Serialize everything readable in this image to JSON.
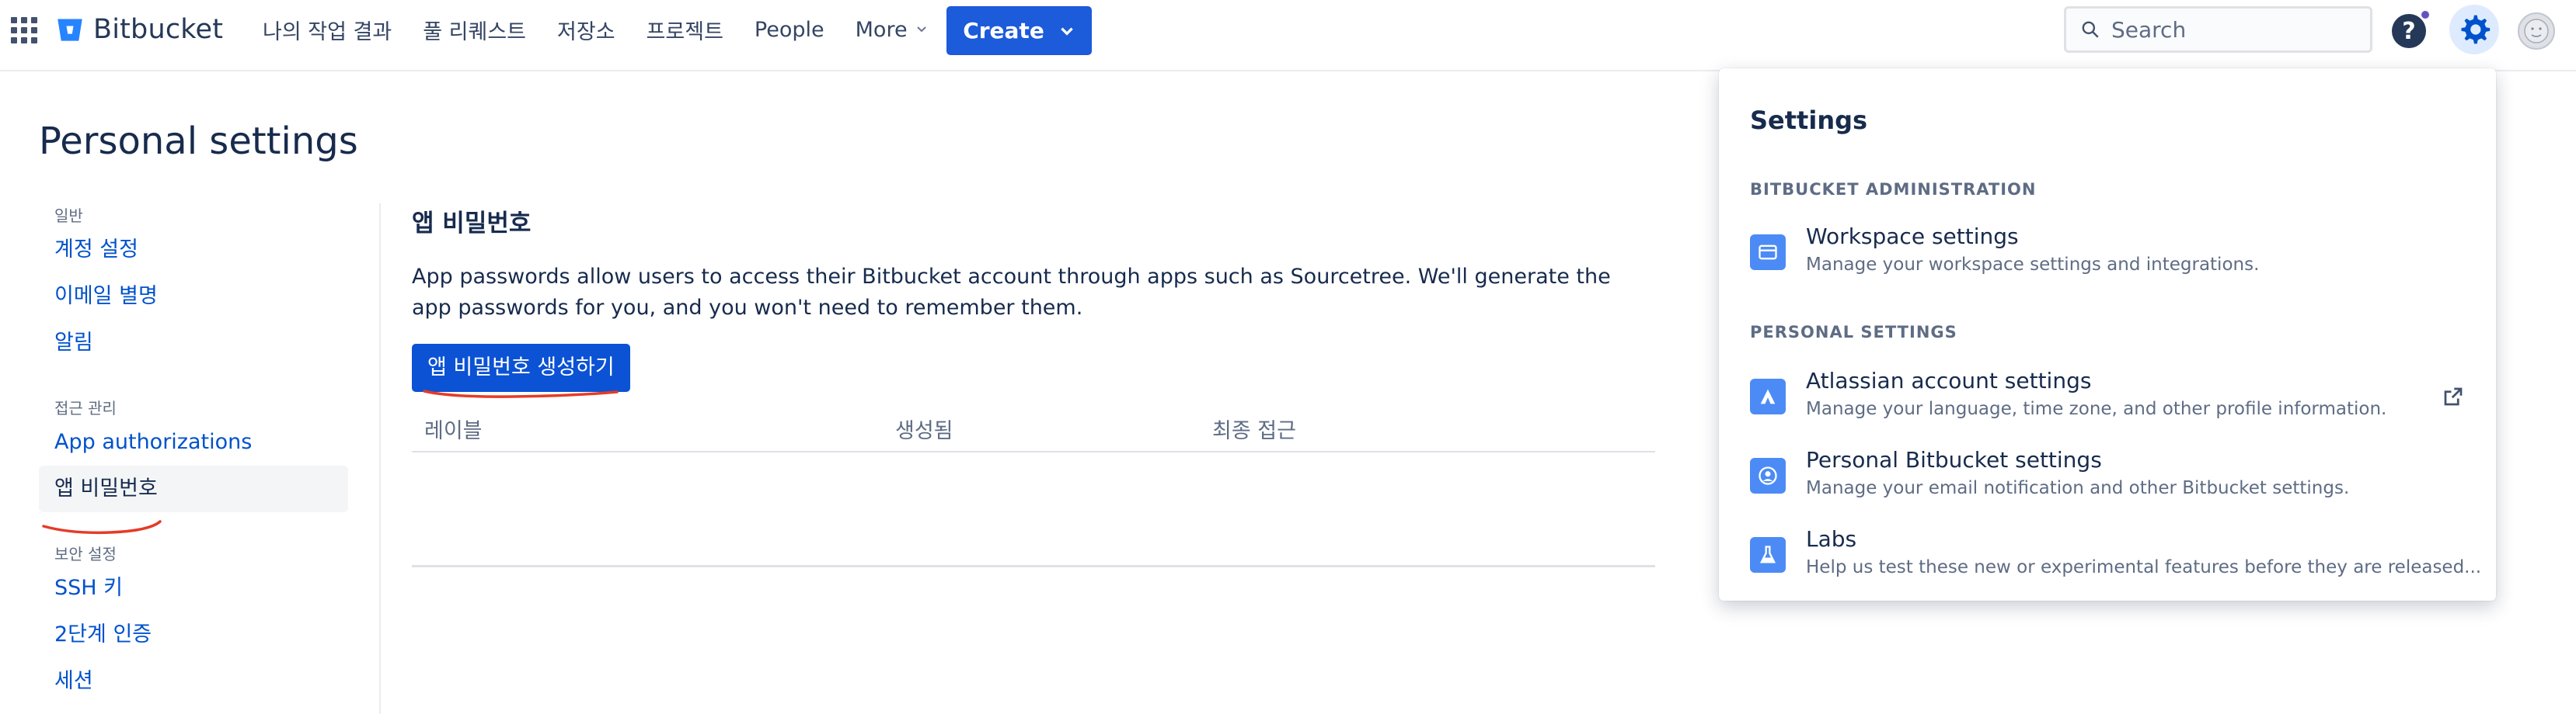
{
  "header": {
    "brand": "Bitbucket",
    "nav": [
      "나의 작업 결과",
      "풀 리퀘스트",
      "저장소",
      "프로젝트",
      "People"
    ],
    "more_label": "More",
    "create_label": "Create",
    "search_placeholder": "Search",
    "help_label": "?"
  },
  "page": {
    "title": "Personal settings"
  },
  "sidebar": {
    "sections": [
      {
        "heading": "일반",
        "items": [
          "계정 설정",
          "이메일 별명",
          "알림"
        ]
      },
      {
        "heading": "접근 관리",
        "items": [
          "App authorizations",
          "앱 비밀번호"
        ]
      },
      {
        "heading": "보안 설정",
        "items": [
          "SSH 키",
          "2단계 인증",
          "세션"
        ]
      }
    ],
    "active_item": "앱 비밀번호"
  },
  "content": {
    "title": "앱 비밀번호",
    "description": "App passwords allow users to access their Bitbucket account through apps such as Sourcetree. We'll generate the app passwords for you, and you won't need to remember them.",
    "create_button": "앱 비밀번호 생성하기",
    "table_headers": [
      "레이블",
      "생성됨",
      "최종 접근"
    ],
    "rows": []
  },
  "settings_dropdown": {
    "title": "Settings",
    "sections": [
      {
        "heading": "BITBUCKET ADMINISTRATION",
        "items": [
          {
            "label": "Workspace settings",
            "description": "Manage your workspace settings and integrations.",
            "icon": "workspace-icon"
          }
        ]
      },
      {
        "heading": "PERSONAL SETTINGS",
        "items": [
          {
            "label": "Atlassian account settings",
            "description": "Manage your language, time zone, and other profile information.",
            "icon": "atlassian-icon",
            "external": true
          },
          {
            "label": "Personal Bitbucket settings",
            "description": "Manage your email notification and other Bitbucket settings.",
            "icon": "person-icon"
          },
          {
            "label": "Labs",
            "description": "Help us test these new or experimental features before they are released...",
            "icon": "flask-icon"
          }
        ]
      }
    ]
  },
  "colors": {
    "brand_blue": "#0052cc",
    "button_blue": "#1c5bd9",
    "annotation_red": "#e53b27"
  }
}
